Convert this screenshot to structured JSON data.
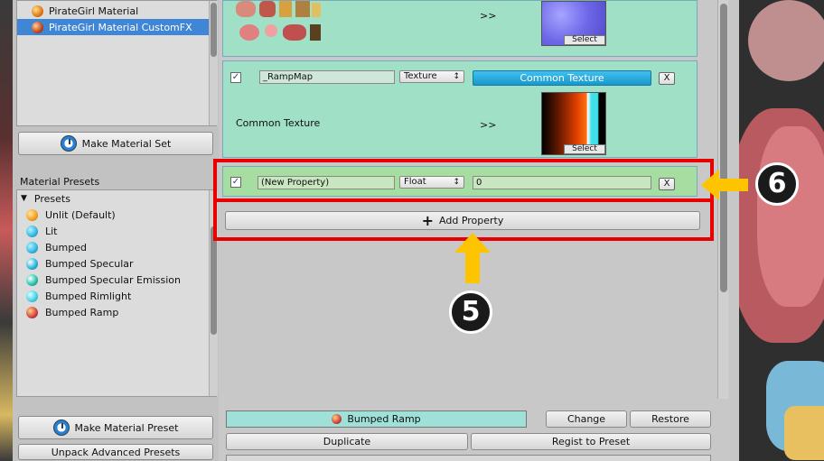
{
  "material_list": {
    "items": [
      {
        "label": "PirateGirl Material",
        "icon": "orange-sphere-icon",
        "selected": false
      },
      {
        "label": "PirateGirl Material CustomFX",
        "icon": "fx-sphere-icon",
        "selected": true
      }
    ]
  },
  "left_panel": {
    "make_material_set": "Make Material Set",
    "material_presets_label": "Material Presets",
    "presets_root": "Presets",
    "presets": [
      {
        "label": "Unlit (Default)",
        "color": "#f0a020"
      },
      {
        "label": "Lit",
        "color": "#30b8e0"
      },
      {
        "label": "Bumped",
        "color": "#30b8e0"
      },
      {
        "label": "Bumped Specular",
        "color": "#30b8e0"
      },
      {
        "label": "Bumped Specular Emission",
        "color": "#30b8e0"
      },
      {
        "label": "Bumped Rimlight",
        "color": "#40d0e8"
      },
      {
        "label": "Bumped Ramp",
        "color": "#d04040"
      }
    ],
    "make_material_preset": "Make Material Preset",
    "unpack_advanced_presets": "Unpack Advanced Presets"
  },
  "properties": {
    "top_card": {
      "arrow": ">>",
      "select_label": "Select"
    },
    "ramp_card": {
      "checked": true,
      "name": "_RampMap",
      "type": "Texture",
      "common_button": "Common Texture",
      "remove": "X",
      "caption": "Common Texture",
      "arrow": ">>",
      "select_label": "Select"
    },
    "new_card": {
      "checked": true,
      "name": "(New Property)",
      "type": "Float",
      "value": "0",
      "remove": "X"
    },
    "add_property": "Add Property"
  },
  "callouts": {
    "step5": "5",
    "step6": "6"
  },
  "bottom": {
    "preset_name": "Bumped Ramp",
    "change": "Change",
    "restore": "Restore",
    "duplicate": "Duplicate",
    "regist_to_preset": "Regist to Preset"
  },
  "colors": {
    "card_green": "#9fe0c7",
    "highlight_red": "#e60000",
    "callout_arrow": "#ffc400",
    "selection_blue": "#3f86d6"
  }
}
